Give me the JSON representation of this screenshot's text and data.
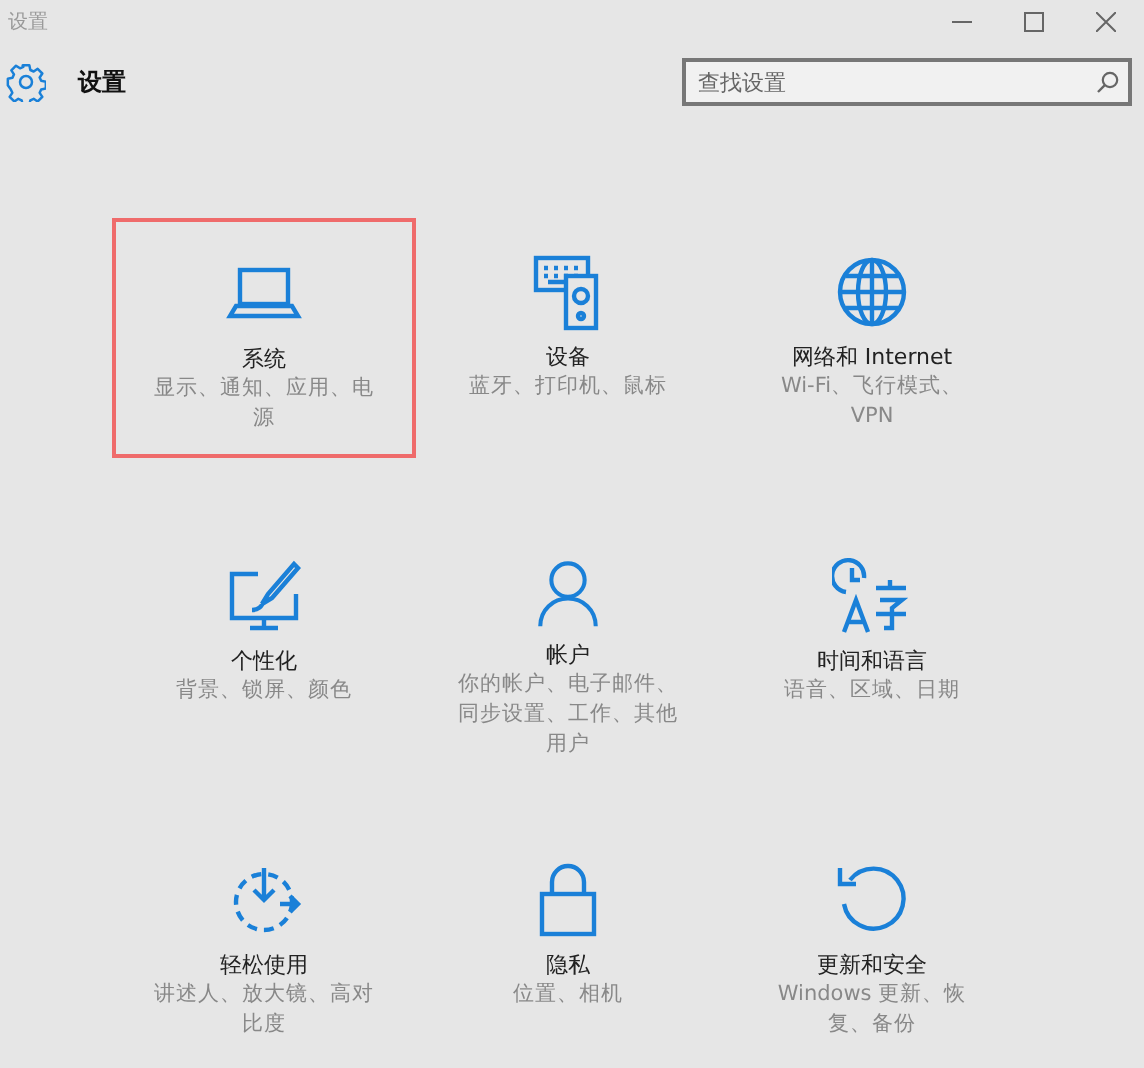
{
  "window": {
    "title": "设置"
  },
  "header": {
    "title": "设置"
  },
  "search": {
    "placeholder": "查找设置"
  },
  "categories": [
    {
      "title": "系统",
      "subtitle": "显示、通知、应用、电源",
      "selected": true
    },
    {
      "title": "设备",
      "subtitle": "蓝牙、打印机、鼠标",
      "selected": false
    },
    {
      "title": "网络和 Internet",
      "subtitle": "Wi-Fi、飞行模式、VPN",
      "selected": false
    },
    {
      "title": "个性化",
      "subtitle": "背景、锁屏、颜色",
      "selected": false
    },
    {
      "title": "帐户",
      "subtitle": "你的帐户、电子邮件、同步设置、工作、其他用户",
      "selected": false
    },
    {
      "title": "时间和语言",
      "subtitle": "语音、区域、日期",
      "selected": false
    },
    {
      "title": "轻松使用",
      "subtitle": "讲述人、放大镜、高对比度",
      "selected": false
    },
    {
      "title": "隐私",
      "subtitle": "位置、相机",
      "selected": false
    },
    {
      "title": "更新和安全",
      "subtitle": "Windows 更新、恢复、备份",
      "selected": false
    }
  ]
}
